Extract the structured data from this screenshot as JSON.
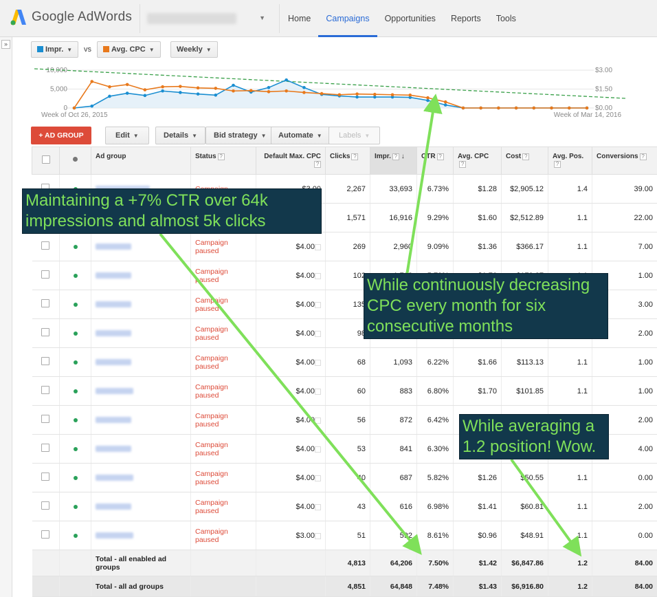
{
  "header": {
    "brand": "Google AdWords",
    "nav": [
      "Home",
      "Campaigns",
      "Opportunities",
      "Reports",
      "Tools"
    ],
    "active_nav": "Campaigns"
  },
  "chart_controls": {
    "metric1": "Impr.",
    "vs": "vs",
    "metric2": "Avg. CPC",
    "period": "Weekly",
    "metric1_color": "#1a8ed1",
    "metric2_color": "#e8791c"
  },
  "chart_data": {
    "type": "line",
    "left_axis_ticks": [
      "10,000",
      "5,000",
      "0"
    ],
    "right_axis_ticks": [
      "$3.00",
      "$1.50",
      "$0.00"
    ],
    "x_start_label": "Week of Oct 26, 2015",
    "x_end_label": "Week of Mar 14, 2016",
    "left_ylim": [
      0,
      10000
    ],
    "right_ylim": [
      0,
      3
    ],
    "series": [
      {
        "name": "Impr.",
        "color": "#1a8ed1",
        "axis": "left",
        "values": [
          0,
          500,
          3100,
          3900,
          3300,
          4500,
          4100,
          3700,
          3400,
          6000,
          4200,
          5400,
          7400,
          5400,
          3600,
          3200,
          2900,
          2900,
          2900,
          2800,
          2000,
          800,
          0,
          0,
          0,
          0,
          0,
          0,
          0,
          0
        ]
      },
      {
        "name": "Avg. CPC",
        "color": "#e8791c",
        "axis": "left",
        "values": [
          0,
          7000,
          5600,
          6200,
          4800,
          5600,
          5700,
          5300,
          5200,
          4500,
          4600,
          4300,
          4500,
          4100,
          3800,
          3500,
          3700,
          3600,
          3500,
          3400,
          2700,
          1600,
          0,
          0,
          0,
          0,
          0,
          0,
          0,
          0
        ]
      }
    ],
    "trendline_color": "#3aa04a",
    "grid": true
  },
  "toolbar": {
    "add_label": "+ AD GROUP",
    "edit": "Edit",
    "details": "Details",
    "bid_strategy": "Bid strategy",
    "automate": "Automate",
    "labels": "Labels"
  },
  "table": {
    "headers": {
      "ad_group": "Ad group",
      "status": "Status",
      "max_cpc": "Default Max. CPC",
      "clicks": "Clicks",
      "impr": "Impr.",
      "ctr": "CTR",
      "avg_cpc": "Avg. CPC",
      "cost": "Cost",
      "avg_pos": "Avg. Pos.",
      "conversions": "Conversions"
    },
    "rows": [
      {
        "ad_group": "SuperbGeneral",
        "status": "Campaign",
        "max_cpc": "$3.00",
        "clicks": "2,267",
        "impr": "33,693",
        "ctr": "6.73%",
        "avg_cpc": "$1.28",
        "cost": "$2,905.12",
        "avg_pos": "1.4",
        "conversions": "39.00"
      },
      {
        "ad_group": "",
        "status": "",
        "max_cpc": "",
        "clicks": "1,571",
        "impr": "16,916",
        "ctr": "9.29%",
        "avg_cpc": "$1.60",
        "cost": "$2,512.89",
        "avg_pos": "1.1",
        "conversions": "22.00"
      },
      {
        "ad_group": "MD80",
        "status": "Campaign paused",
        "max_cpc": "$4.00",
        "clicks": "269",
        "impr": "2,960",
        "ctr": "9.09%",
        "avg_cpc": "$1.36",
        "cost": "$366.17",
        "avg_pos": "1.1",
        "conversions": "7.00"
      },
      {
        "ad_group": "HD75",
        "status": "Campaign paused",
        "max_cpc": "$4.00",
        "clicks": "102",
        "impr": "1,762",
        "ctr": "5.79%",
        "avg_cpc": "$1.76",
        "cost": "$179.27",
        "avg_pos": "1.1",
        "conversions": "1.00"
      },
      {
        "ad_group": "MD68",
        "status": "Campaign paused",
        "max_cpc": "$4.00",
        "clicks": "135",
        "impr": "",
        "ctr": "",
        "avg_cpc": "",
        "cost": "",
        "avg_pos": "",
        "conversions": "3.00"
      },
      {
        "ad_group": "EX80",
        "status": "Campaign paused",
        "max_cpc": "$4.00",
        "clicks": "98",
        "impr": "",
        "ctr": "",
        "avg_cpc": "",
        "cost": "",
        "avg_pos": "",
        "conversions": "2.00"
      },
      {
        "ad_group": "EX75",
        "status": "Campaign paused",
        "max_cpc": "$4.00",
        "clicks": "68",
        "impr": "1,093",
        "ctr": "6.22%",
        "avg_cpc": "$1.66",
        "cost": "$113.13",
        "avg_pos": "1.1",
        "conversions": "1.00"
      },
      {
        "ad_group": "VXF80",
        "status": "Campaign paused",
        "max_cpc": "$4.00",
        "clicks": "60",
        "impr": "883",
        "ctr": "6.80%",
        "avg_cpc": "$1.70",
        "cost": "$101.85",
        "avg_pos": "1.1",
        "conversions": "1.00"
      },
      {
        "ad_group": "EX90",
        "status": "Campaign paused",
        "max_cpc": "$4.00",
        "clicks": "56",
        "impr": "872",
        "ctr": "6.42%",
        "avg_cpc": "$1.60",
        "cost": "",
        "avg_pos": "",
        "conversions": "2.00"
      },
      {
        "ad_group": "EX85",
        "status": "Campaign paused",
        "max_cpc": "$4.00",
        "clicks": "53",
        "impr": "841",
        "ctr": "6.30%",
        "avg_cpc": "",
        "cost": "",
        "avg_pos": "",
        "conversions": "4.00"
      },
      {
        "ad_group": "CM100",
        "status": "Campaign paused",
        "max_cpc": "$4.00",
        "clicks": "40",
        "impr": "687",
        "ctr": "5.82%",
        "avg_cpc": "$1.26",
        "cost": "$50.55",
        "avg_pos": "1.1",
        "conversions": "0.00"
      },
      {
        "ad_group": "HD80",
        "status": "Campaign paused",
        "max_cpc": "$4.00",
        "clicks": "43",
        "impr": "616",
        "ctr": "6.98%",
        "avg_cpc": "$1.41",
        "cost": "$60.81",
        "avg_pos": "1.1",
        "conversions": "2.00"
      },
      {
        "ad_group": "VMD75",
        "status": "Campaign paused",
        "max_cpc": "$3.00",
        "clicks": "51",
        "impr": "592",
        "ctr": "8.61%",
        "avg_cpc": "$0.96",
        "cost": "$48.91",
        "avg_pos": "1.1",
        "conversions": "0.00"
      }
    ],
    "total_enabled": {
      "label": "Total - all enabled ad groups",
      "clicks": "4,813",
      "impr": "64,206",
      "ctr": "7.50%",
      "avg_cpc": "$1.42",
      "cost": "$6,847.86",
      "avg_pos": "1.2",
      "conversions": "84.00"
    },
    "total_all": {
      "label": "Total - all ad groups",
      "clicks": "4,851",
      "impr": "64,848",
      "ctr": "7.48%",
      "avg_cpc": "$1.43",
      "cost": "$6,916.80",
      "avg_pos": "1.2",
      "conversions": "84.00"
    }
  },
  "annotations": {
    "ctr": "Maintaining a +7% CTR over 64k impressions and almost 5k clicks",
    "cpc": "While continuously decreasing CPC every month for six consecutive months",
    "position": "While averaging a 1.2 position! Wow.",
    "text_color": "#7fe05a",
    "bg_color": "#12384b"
  }
}
